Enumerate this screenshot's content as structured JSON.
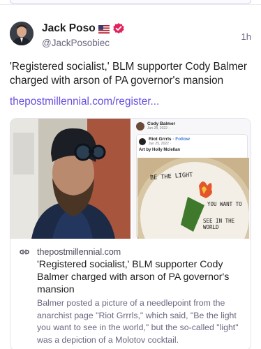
{
  "author": {
    "display_name": "Jack Poso",
    "handle": "@JackPosobiec",
    "timestamp": "1h",
    "badges": [
      "us-flag-icon",
      "verified-icon"
    ]
  },
  "post": {
    "text": "'Registered socialist,' BLM supporter Cody Balmer charged with arson of PA governor's mansion",
    "link_text": "thepostmillennial.com/register..."
  },
  "card": {
    "site": "thepostmillennial.com",
    "title": "'Registered socialist,' BLM supporter Cody Balmer charged with arson of PA governor's mansion",
    "description": "Balmer posted a picture of a needlepoint from the anarchist page \"Riot Grrrls,\" which said, \"Be the light you want to see in the world,\" but the so-called \"light\" was a depiction of a Molotov cocktail.",
    "embedded_screenshot": {
      "outer_name": "Cody Balmer",
      "outer_date": "Jun 28, 2022 · ",
      "inner_name": "Riot Grrrls",
      "inner_follow": "· Follow",
      "inner_date": "Jun 25, 2022 · ",
      "art_credit": "Art by Holly Mclellan",
      "needlepoint_lines": [
        "BE THE LIGHT",
        "YOU WANT TO",
        "SEE IN THE WORLD"
      ]
    }
  },
  "colors": {
    "link": "#6a4de0",
    "verified": "#e0245e",
    "text": "#1d1d20",
    "muted": "#6b6680"
  }
}
